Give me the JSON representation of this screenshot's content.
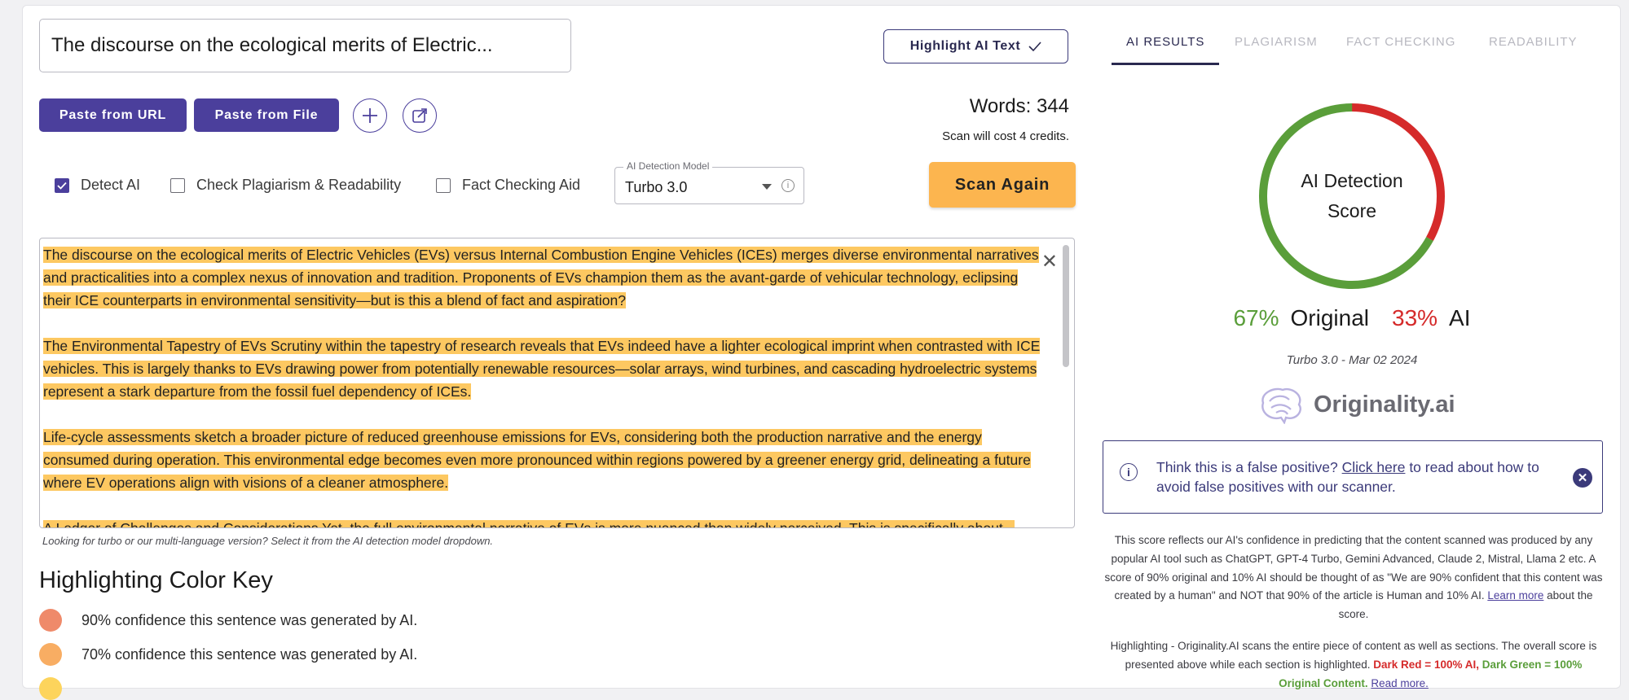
{
  "document": {
    "title_value": "The discourse on the ecological merits of Electric...",
    "highlight_button": "Highlight AI Text",
    "paste_url": "Paste from URL",
    "paste_file": "Paste from File",
    "words": "Words: 344",
    "cost": "Scan will cost 4 credits.",
    "options": {
      "detect_ai": "Detect AI",
      "plagiarism": "Check Plagiarism & Readability",
      "fact": "Fact Checking Aid"
    },
    "model_legend": "AI Detection Model",
    "model_value": "Turbo 3.0",
    "scan_button": "Scan Again",
    "paragraphs": [
      "The discourse on the ecological merits of Electric Vehicles (EVs) versus Internal Combustion Engine Vehicles (ICEs) merges diverse environmental narratives and practicalities into a complex nexus of innovation and tradition. Proponents of EVs champion them as the avant-garde of vehicular technology, eclipsing their ICE counterparts in environmental sensitivity—but is this a blend of fact and aspiration?",
      "The Environmental Tapestry of EVs Scrutiny within the tapestry of research reveals that EVs indeed have a lighter ecological imprint when contrasted with ICE vehicles. This is largely thanks to EVs drawing power from potentially renewable resources—solar arrays, wind turbines, and cascading hydroelectric systems represent a stark departure from the fossil fuel dependency of ICEs.",
      "Life-cycle assessments sketch a broader picture of reduced greenhouse emissions for EVs, considering both the production narrative and the energy consumed during operation. This environmental edge becomes even more pronounced within regions powered by a greener energy grid, delineating a future where EV operations align with visions of a cleaner atmosphere.",
      "A Ledger of Challenges and Considerations Yet, the full environmental narrative of EVs is more nuanced than widely perceived. This is specifically about..."
    ],
    "hint": "Looking for turbo or our multi-language version? Select it from the AI detection model dropdown.",
    "key_title": "Highlighting Color Key",
    "key_rows": [
      {
        "label": "90% confidence this sentence was generated by AI.",
        "color": "#ef8a6a"
      },
      {
        "label": "70% confidence this sentence was generated by AI.",
        "color": "#f8ad63"
      },
      {
        "label": "",
        "color": "#fdd45c"
      }
    ]
  },
  "results": {
    "tabs": [
      "AI RESULTS",
      "PLAGIARISM",
      "FACT CHECKING",
      "READABILITY"
    ],
    "score_label_line1": "AI Detection",
    "score_label_line2": "Score",
    "original_pct": "67%",
    "original_label": "Original",
    "ai_pct": "33%",
    "ai_label": "AI",
    "original_fraction": 0.67,
    "colors": {
      "original": "#5a9e3a",
      "ai": "#d52a2a"
    },
    "model_date": "Turbo 3.0 - Mar 02 2024",
    "brand": "Originality.ai",
    "fp_prefix": "Think this is a false positive?",
    "fp_link": "Click here",
    "fp_suffix": "to read about how to avoid false positives with our scanner.",
    "explain_text": "This score reflects our AI's confidence in predicting that the content scanned was produced by any popular AI tool such as ChatGPT, GPT-4 Turbo, Gemini Advanced, Claude 2, Mistral, Llama 2 etc. A score of 90% original and 10% AI should be thought of as \"We are 90% confident that this content was created by a human\" and NOT that 90% of the article is Human and 10% AI.",
    "explain_link": "Learn more",
    "explain_tail": "about the score.",
    "highlight_text": "Highlighting - Originality.AI scans the entire piece of content as well as sections. The overall score is presented above while each section is highlighted.",
    "dark_red": "Dark Red = 100% AI,",
    "dark_green": "Dark Green = 100% Original Content.",
    "read_more": "Read more."
  }
}
